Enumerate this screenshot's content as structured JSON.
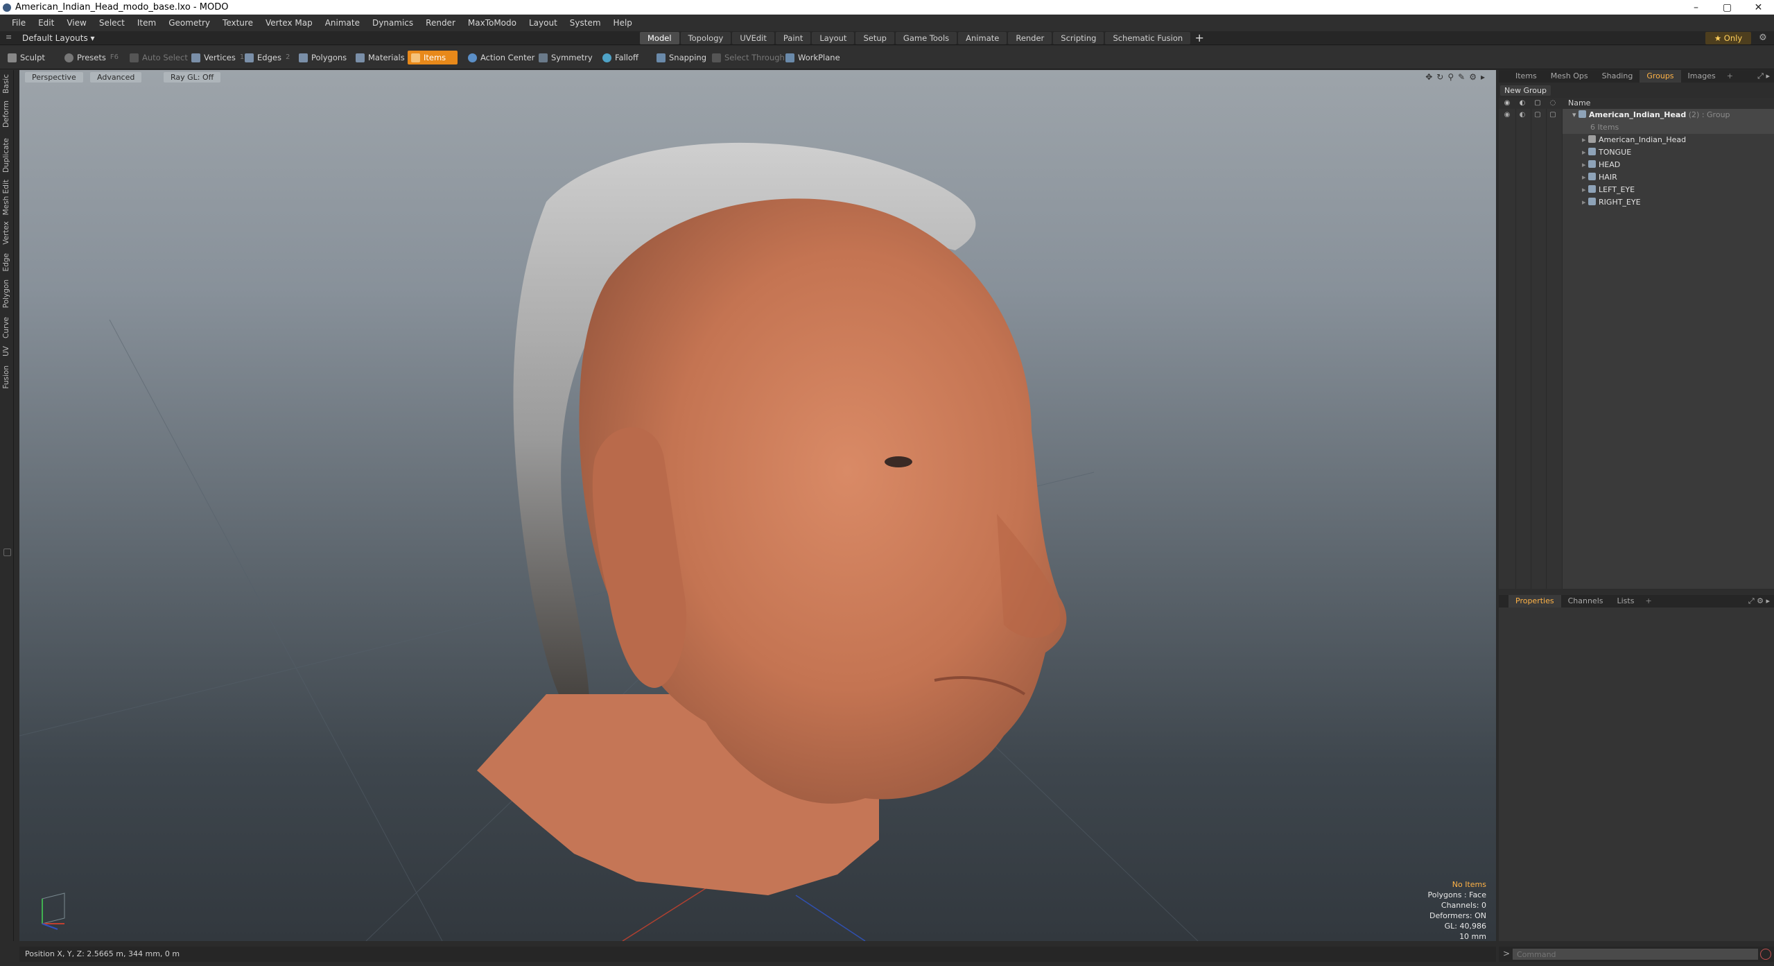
{
  "window": {
    "title": "American_Indian_Head_modo_base.lxo - MODO",
    "controls": [
      "–",
      "▢",
      "✕"
    ]
  },
  "menu": [
    "File",
    "Edit",
    "View",
    "Select",
    "Item",
    "Geometry",
    "Texture",
    "Vertex Map",
    "Animate",
    "Dynamics",
    "Render",
    "MaxToModo",
    "Layout",
    "System",
    "Help"
  ],
  "layout": {
    "dropdown": "Default Layouts ▾",
    "tabs": [
      "Model",
      "Topology",
      "UVEdit",
      "Paint",
      "Layout",
      "Setup",
      "Game Tools",
      "Animate",
      "Render",
      "Scripting",
      "Schematic Fusion"
    ],
    "active_tab": "Model",
    "add": "+",
    "only": "★ Only"
  },
  "toolbar": {
    "sculpt": "Sculpt",
    "presets": "Presets",
    "presets_key": "F6",
    "auto_select": "Auto Select",
    "vertices": "Vertices",
    "vertices_key": "1",
    "edges": "Edges",
    "edges_key": "2",
    "polygons": "Polygons",
    "materials": "Materials",
    "items": "Items",
    "action_center": "Action Center",
    "symmetry": "Symmetry",
    "falloff": "Falloff",
    "snapping": "Snapping",
    "select_through": "Select Through",
    "workplane": "WorkPlane"
  },
  "left_tabs": [
    "Basic",
    "Deform",
    "Duplicate",
    "Mesh Edit",
    "Vertex",
    "Edge",
    "Polygon",
    "Curve",
    "UV",
    "Fusion"
  ],
  "viewport": {
    "view": "Perspective",
    "mode": "Advanced",
    "raygl": "Ray GL: Off",
    "info": {
      "no_items": "No Items",
      "polygons": "Polygons : Face",
      "channels": "Channels: 0",
      "deformers": "Deformers: ON",
      "gl": "GL: 40,986",
      "scale": "10 mm"
    }
  },
  "status": {
    "position": "Position X, Y, Z:   2.5665 m, 344 mm, 0 m"
  },
  "right_panel": {
    "tabs": [
      "Items",
      "Mesh Ops",
      "Shading",
      "Groups",
      "Images"
    ],
    "active_tab": "Groups",
    "new_group": "New Group",
    "column_name": "Name",
    "group": {
      "name": "American_Indian_Head",
      "count": "(2)",
      "type": ": Group",
      "items_count": "6 Items"
    },
    "items": [
      "American_Indian_Head",
      "TONGUE",
      "HEAD",
      "HAIR",
      "LEFT_EYE",
      "RIGHT_EYE"
    ],
    "prop_tabs": [
      "Properties",
      "Channels",
      "Lists"
    ],
    "prop_active": "Properties"
  },
  "command": {
    "prompt": ">",
    "placeholder": "Command"
  },
  "colors": {
    "accent": "#e8891a",
    "highlight_text": "#ffb347",
    "skin": "#c9795a",
    "hair": "#8d8d8d"
  }
}
